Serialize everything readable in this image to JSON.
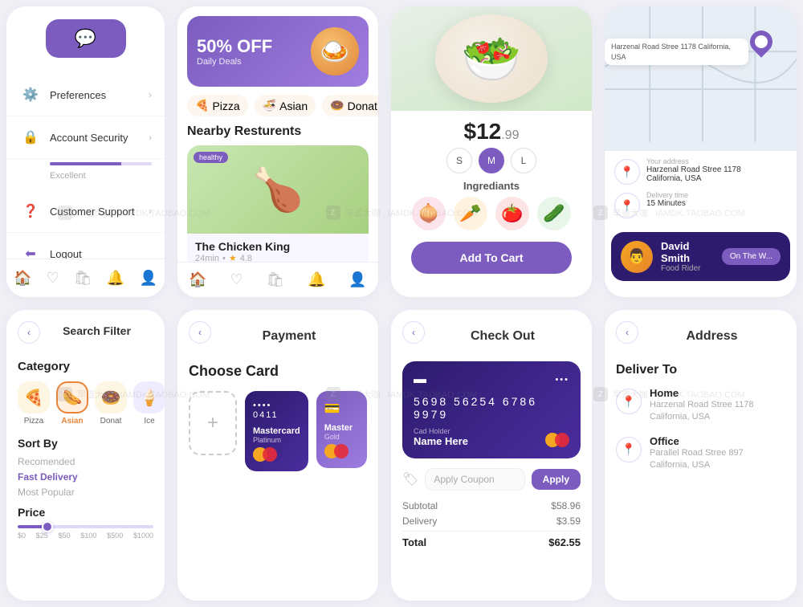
{
  "topLeft": {
    "chatIcon": "💬",
    "menuItems": [
      {
        "icon": "⚙️",
        "label": "Preferences",
        "arrow": "›"
      },
      {
        "icon": "🔒",
        "label": "Account Security",
        "arrow": "›"
      },
      {
        "icon": "❓",
        "label": "Customer Support",
        "arrow": "›"
      },
      {
        "icon": "→",
        "label": "Logout",
        "arrow": ""
      }
    ],
    "securityLabel": "Excellent",
    "navIcons": [
      "🏠",
      "♡",
      "🛍",
      "🔔",
      "👤"
    ]
  },
  "topCenterLeft": {
    "promoBanner": {
      "off": "50% OFF",
      "sub": "Daily Deals",
      "emoji": "🍛"
    },
    "categories": [
      {
        "label": "Pizza",
        "emoji": "🍕"
      },
      {
        "label": "Asian",
        "emoji": "🍜"
      },
      {
        "label": "Donat",
        "emoji": "🍩"
      }
    ],
    "sectionTitle": "Nearby Resturents",
    "restaurant": {
      "badge": "healthy",
      "name": "The Chicken King",
      "time": "24min",
      "rating": "4.8",
      "emoji": "🍗"
    },
    "navIcons": [
      "🏠",
      "♡",
      "🛍",
      "🔔",
      "👤"
    ]
  },
  "topCenterRight": {
    "price": {
      "big": "$12",
      "small": ".99"
    },
    "sizes": [
      "S",
      "M",
      "L"
    ],
    "activeSize": "M",
    "ingredientsTitle": "Ingrediants",
    "ingredients": [
      "🧅",
      "🥕",
      "🍅",
      "🥒"
    ],
    "addToCartLabel": "Add To Cart",
    "foodEmoji": "🥗"
  },
  "topRight": {
    "mapAddress": "Harzenal Road Stree 1178\nCalifornia, USA",
    "rider": {
      "name": "David Smith",
      "role": "Food Rider",
      "emoji": "👨",
      "onWay": "On The W..."
    },
    "routeAddress1": "Harzenal Road Stree 1178\nCalifornia, USA",
    "routeAddress2": "Delivery time\n15 Minutes"
  },
  "bottomLeft": {
    "backIcon": "‹",
    "title": "Search Filter",
    "categoryTitle": "Category",
    "categories": [
      {
        "emoji": "🍕",
        "label": "Pizza",
        "active": false
      },
      {
        "emoji": "🌭",
        "label": "Asian",
        "active": true
      },
      {
        "emoji": "🍩",
        "label": "Donat",
        "active": false
      },
      {
        "emoji": "🍦",
        "label": "Ice",
        "active": false
      }
    ],
    "sortByTitle": "Sort By",
    "sortOptions": [
      {
        "label": "Recomended",
        "active": false
      },
      {
        "label": "Fast Delivery",
        "active": true
      }
    ],
    "mostPopular": "Most Popular",
    "priceTitle": "Price",
    "priceLabels": [
      "$0",
      "$25",
      "$50",
      "$100",
      "$500",
      "$1000"
    ]
  },
  "bottomCenterLeft": {
    "backIcon": "‹",
    "paymentTitle": "Payment",
    "chooseCardTitle": "Choose Card",
    "addCardIcon": "+",
    "cards": [
      {
        "dots": "•••• ",
        "last4": "0411",
        "brand": "Mastercard",
        "sub": "Platinum",
        "type": "dark"
      },
      {
        "dots": "",
        "last4": "",
        "brand": "Master",
        "sub": "Gold",
        "type": "purple"
      }
    ]
  },
  "bottomCenterRight": {
    "backIcon": "‹",
    "checkoutTitle": "Check Out",
    "cardNumber": "5698  56254  6786  9979",
    "cardHolderLabel": "Cad Holder",
    "cardHolderName": "Name Here",
    "couponPlaceholder": "Apply Coupon",
    "applyLabel": "Apply",
    "subtotalLabel": "Subtotal",
    "subtotalValue": "$58.96",
    "deliveryLabel": "Delivery",
    "deliveryValue": "$3.59",
    "totalLabel": "Total",
    "totalValue": "$62.55"
  },
  "bottomRight": {
    "backIcon": "‹",
    "addressTitle": "Address",
    "deliverToTitle": "Deliver To",
    "addresses": [
      {
        "label": "Home",
        "line1": "Harzenal Road Stree 1178",
        "line2": "California, USA"
      },
      {
        "label": "Office",
        "line1": "Parallel Road Stree 897",
        "line2": "California, USA"
      }
    ]
  },
  "colors": {
    "purple": "#7c5cbf",
    "darkPurple": "#2d1b6e"
  }
}
